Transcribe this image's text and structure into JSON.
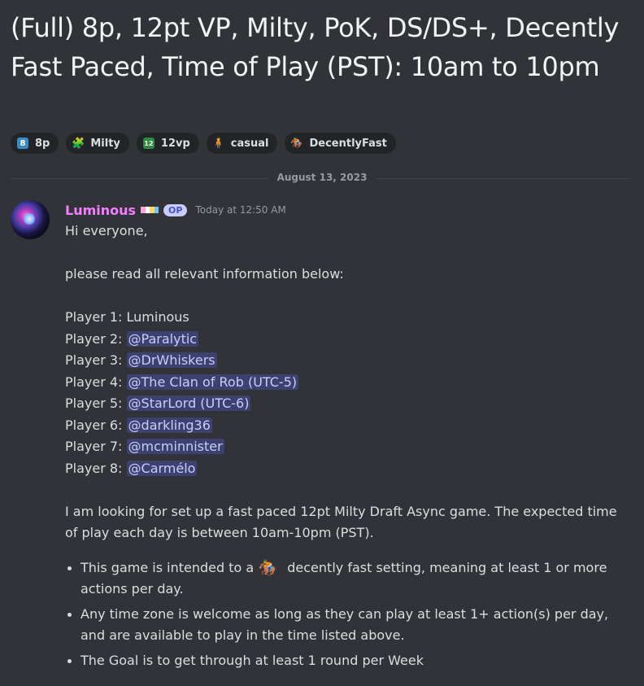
{
  "thread": {
    "title": "(Full) 8p, 12pt VP, Milty, PoK, DS/DS+, Decently Fast Paced, Time of Play (PST): 10am to 10pm"
  },
  "tags": [
    {
      "label": "8p",
      "icon": "number-8-icon",
      "color": "#3b88c3",
      "glyph": "8"
    },
    {
      "label": "Milty",
      "icon": "puzzle-icon",
      "color": "#232428",
      "glyph": "🧩"
    },
    {
      "label": "12vp",
      "icon": "number-12-icon",
      "color": "#2e8b3e",
      "glyph": "12"
    },
    {
      "label": "casual",
      "icon": "person-icon",
      "color": "#232428",
      "glyph": "🧍"
    },
    {
      "label": "DecentlyFast",
      "icon": "horse-racing-icon",
      "color": "#232428",
      "glyph": "🏇"
    }
  ],
  "divider": {
    "date": "August 13, 2023"
  },
  "message": {
    "author": "Luminous",
    "op_badge": "OP",
    "timestamp": "Today at 12:50 AM",
    "greeting": "Hi everyone,",
    "intro": "please read all relevant information below:",
    "players": [
      {
        "label": "Player 1: ",
        "name": "Luminous",
        "mention": false
      },
      {
        "label": "Player 2: ",
        "name": "@Paralytic",
        "mention": true
      },
      {
        "label": "Player 3: ",
        "name": "@DrWhiskers",
        "mention": true
      },
      {
        "label": "Player 4: ",
        "name": "@The Clan of Rob (UTC-5)",
        "mention": true
      },
      {
        "label": "Player 5: ",
        "name": "@StarLord (UTC-6)",
        "mention": true
      },
      {
        "label": "Player 6: ",
        "name": "@darkling36",
        "mention": true
      },
      {
        "label": "Player 7: ",
        "name": "@mcminnister",
        "mention": true
      },
      {
        "label": "Player 8: ",
        "name": "@Carmélo",
        "mention": true
      }
    ],
    "description": "I am looking for set up a fast paced 12pt Milty Draft Async game. The expected time of play each day is between 10am-10pm (PST).",
    "bullets": [
      {
        "before": "This game is intended to  a",
        "emoji": "🏇",
        "after": " decently fast setting, meaning at least 1 or more actions per day."
      },
      {
        "before": "Any time zone is welcome as long as they can play at least 1+ action(s) per day, and are available to play in the time listed above.",
        "emoji": "",
        "after": ""
      },
      {
        "before": "The Goal is to get through at least 1 round per Week",
        "emoji": "",
        "after": ""
      }
    ]
  },
  "colors": {
    "background": "#313338",
    "username": "#f47fff",
    "mention_text": "#c9cdfb"
  }
}
